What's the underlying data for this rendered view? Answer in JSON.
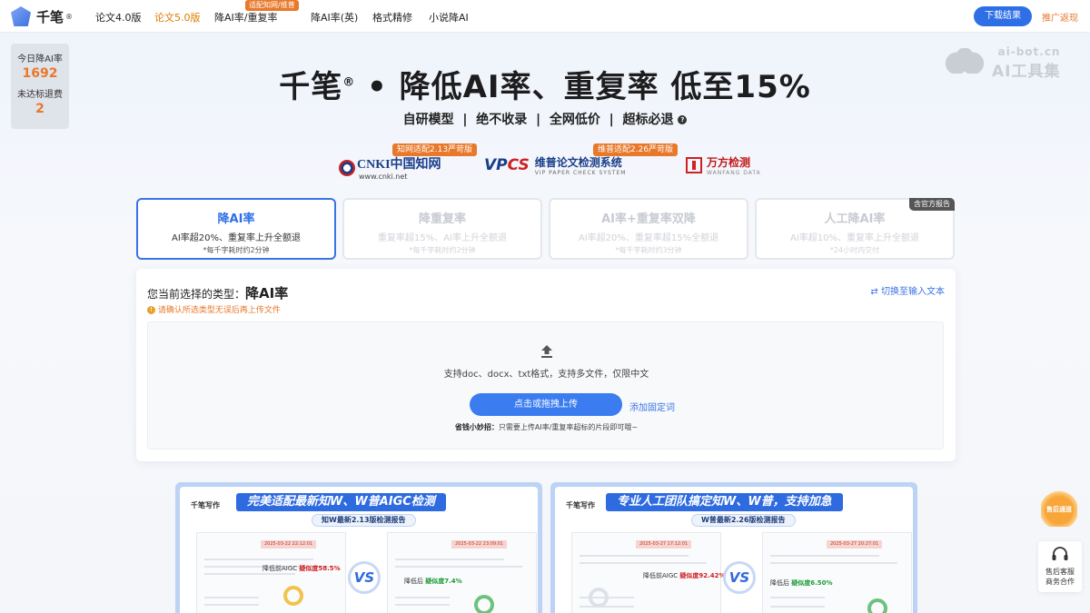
{
  "nav": {
    "brand": "千笔",
    "brand_reg": "®",
    "items": [
      {
        "label": "论文4.0版"
      },
      {
        "label": "论文5.0版"
      },
      {
        "label": "降AI率/重复率"
      },
      {
        "label": "降AI率(英)"
      },
      {
        "label": "格式精修"
      },
      {
        "label": "小说降AI"
      }
    ],
    "badge": "适配知网/维普",
    "download_button": "下载结果",
    "promo_link": "推广返现"
  },
  "stats": {
    "today_label": "今日降AI率",
    "today_value": "1692",
    "refund_label": "未达标退费",
    "refund_value": "2"
  },
  "watermark": {
    "url": "ai-bot.cn",
    "text": "AI工具集"
  },
  "hero": {
    "title_brand": "千笔",
    "title_reg": "®",
    "title_rest": " • 降低AI率、重复率  低至15%",
    "subtitle": "自研模型  |  绝不收录  |  全网低价  |  超标必退",
    "help_icon": "?"
  },
  "partners": {
    "cnki_logo": "CNKI中国知网",
    "cnki_url": "www.cnki.net",
    "cnki_badge": "知网适配2.13严苛版",
    "vpcs_logo_a": "VP",
    "vpcs_logo_b": "CS",
    "vpcs_cn": "维普论文检测系统",
    "vpcs_en": "VIP PAPER CHECK SYSTEM",
    "vpcs_badge": "维普适配2.26严苛版",
    "wanfang_cn": "万方检测",
    "wanfang_en": "WANFANG DATA"
  },
  "tabs": [
    {
      "title": "降AI率",
      "desc": "AI率超20%、重复率上升全额退",
      "note": "*每千字耗时约2分钟",
      "active": true
    },
    {
      "title": "降重复率",
      "desc": "重复率超15%、AI率上升全额退",
      "note": "*每千字耗时约2分钟",
      "active": false
    },
    {
      "title": "AI率+重复率双降",
      "desc": "AI率超20%、重复率超15%全额退",
      "note": "*每千字耗时约3分钟",
      "active": false
    },
    {
      "title": "人工降AI率",
      "desc": "AI率超10%、重复率上升全额退",
      "note": "*24小时内交付",
      "active": false,
      "tag": "含官方报告"
    }
  ],
  "upload": {
    "selected_prefix": "您当前选择的类型：",
    "selected_type": "降AI率",
    "warning": "请确认所选类型无误后再上传文件",
    "switch_link": "切换至输入文本",
    "formats_hint": "支持doc、docx、txt格式，支持多文件，仅限中文",
    "upload_button": "点击或拖拽上传",
    "add_words_link": "添加固定词",
    "tip_label": "省钱小妙招：",
    "tip_text": "只需要上传AI率/重复率超标的片段即可哦~"
  },
  "reports": [
    {
      "brand": "千笔写作",
      "title": "完美适配最新知W、W普AIGC检测",
      "subtitle": "知W最新2.13版检测报告",
      "date_before": "2025-03-22 22:12:01",
      "date_after": "2025-03-22 23:09:01",
      "before_label": "降低前AIGC",
      "before_value": "疑似度58.5%",
      "after_label": "降低后",
      "after_value": "疑似度7.4%",
      "vs": "VS"
    },
    {
      "brand": "千笔写作",
      "title": "专业人工团队搞定知W、W普，支持加急",
      "subtitle": "W普最新2.26版检测报告",
      "date_before": "2025-03-27 17:12:01",
      "date_after": "2025-03-27 20:27:01",
      "before_label": "降低前AIGC",
      "before_value": "疑似度92.42%",
      "after_label": "降低后",
      "after_value": "疑似度6.50%",
      "vs": "VS"
    }
  ],
  "float": {
    "gift_label": "售后通道",
    "service_label_1": "售后客服",
    "service_label_2": "商务合作"
  },
  "colors": {
    "primary": "#2f6fe6",
    "accent": "#e8782a"
  }
}
